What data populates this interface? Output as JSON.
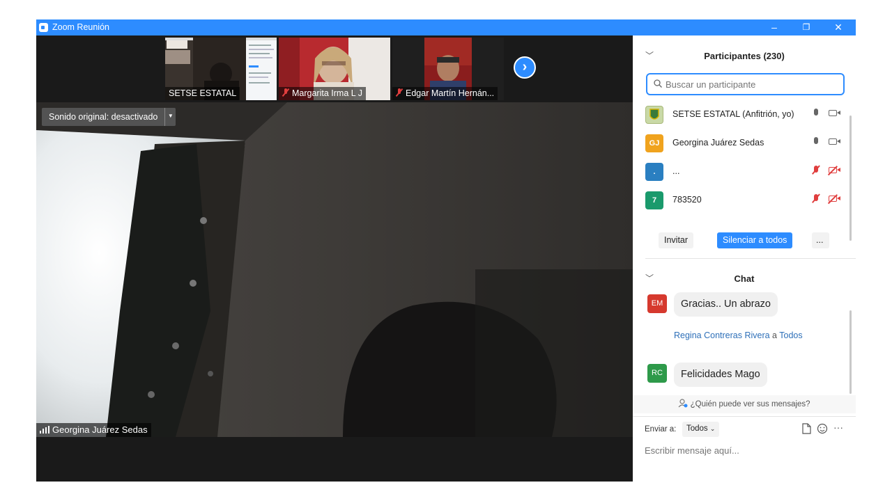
{
  "window": {
    "title": "Zoom Reunión",
    "minimize_glyph": "–",
    "restore_glyph": "❐",
    "close_glyph": "✕"
  },
  "thumbnails": [
    {
      "name": "SETSE ESTATAL",
      "muted": false
    },
    {
      "name": "Margarita Irma L J",
      "muted": true
    },
    {
      "name": "Edgar Martín Hernán...",
      "muted": true
    }
  ],
  "next_page_glyph": "›",
  "main_video": {
    "sound_button": "Sonido original: desactivado",
    "speaker": "Georgina Juárez Sedas"
  },
  "participants": {
    "title": "Participantes (230)",
    "search_placeholder": "Buscar un participante",
    "items": [
      {
        "initials": "",
        "name": "SETSE ESTATAL (Anfitrión, yo)",
        "color": "#c9d9a6",
        "muted": false
      },
      {
        "initials": "GJ",
        "name": "Georgina Juárez Sedas",
        "color": "#f0a31e",
        "muted": false
      },
      {
        "initials": ".",
        "name": "...",
        "color": "#2a7fc1",
        "muted": true
      },
      {
        "initials": "7",
        "name": "783520",
        "color": "#1a9a6c",
        "muted": true
      }
    ],
    "invite_label": "Invitar",
    "mute_all_label": "Silenciar a todos",
    "more_label": "..."
  },
  "chat": {
    "title": "Chat",
    "messages": [
      {
        "initials": "EM",
        "avatar_color": "#d6392e",
        "sender": "",
        "recipient": "",
        "text": "Gracias.. Un abrazo"
      },
      {
        "initials": "RC",
        "avatar_color": "#2e9a4a",
        "sender": "Regina Contreras Rivera",
        "connector": "a",
        "recipient": "Todos",
        "text": "Felicidades Mago"
      }
    ],
    "who_can_see": "¿Quién puede ver sus mensajes?",
    "send_to_label": "Enviar a:",
    "send_to_value": "Todos",
    "input_placeholder": "Escribir mensaje aquí..."
  },
  "colors": {
    "zoom_blue": "#2d8cff",
    "muted_red": "#e03e3e"
  }
}
